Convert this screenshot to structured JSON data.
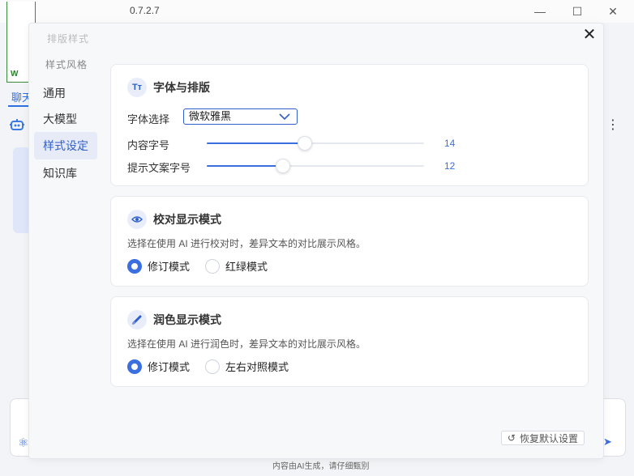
{
  "app": {
    "version_text": "0.7.2.7"
  },
  "window_controls": {
    "minimize": "—",
    "maximize": "☐",
    "close": "✕"
  },
  "background": {
    "logo_text": "W",
    "chat_tab": "聊天",
    "disclaimer": "内容由AI生成，请仔细甄别"
  },
  "dialog": {
    "close": "✕",
    "sidebar": {
      "faded_header": "排版样式",
      "faded_subheader": "样式风格",
      "items": [
        {
          "label": "通用",
          "active": false
        },
        {
          "label": "大模型",
          "active": false
        },
        {
          "label": "样式设定",
          "active": true
        },
        {
          "label": "知识库",
          "active": false
        }
      ]
    },
    "font_card": {
      "title": "字体与排版",
      "icon_text": "Tт",
      "font_select_label": "字体选择",
      "font_select_value": "微软雅黑",
      "content_size_label": "内容字号",
      "content_size_value": "14",
      "content_size_fraction": 0.45,
      "hint_size_label": "提示文案字号",
      "hint_size_value": "12",
      "hint_size_fraction": 0.35
    },
    "proof_card": {
      "title": "校对显示模式",
      "description": "选择在使用 AI 进行校对时，差异文本的对比展示风格。",
      "option_revision": "修订模式",
      "option_redgreen": "红绿模式",
      "selected": "revision"
    },
    "polish_card": {
      "title": "润色显示模式",
      "description": "选择在使用 AI 进行润色时，差异文本的对比展示风格。",
      "option_revision": "修订模式",
      "option_sidebyside": "左右对照模式",
      "selected": "revision"
    },
    "reset_label": "恢复默认设置"
  },
  "colors": {
    "accent": "#3b6fe0",
    "active_bg": "#e6ebf7"
  }
}
